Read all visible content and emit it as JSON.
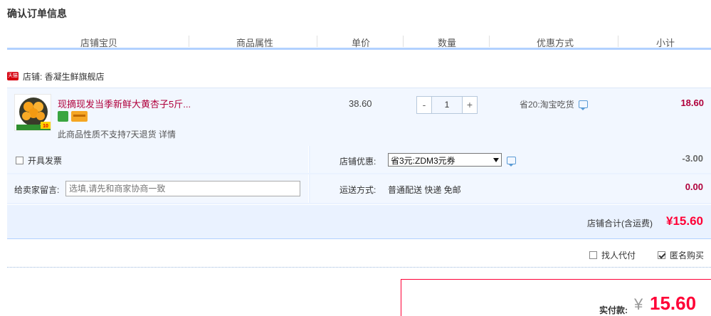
{
  "page": {
    "title": "确认订单信息"
  },
  "columns": [
    "店铺宝贝",
    "商品属性",
    "单价",
    "数量",
    "优惠方式",
    "小计"
  ],
  "shop": {
    "badge": "天猫",
    "label": "店铺: 香凝生鲜旗舰店"
  },
  "item": {
    "title": "现摘现发当季新鲜大黄杏子5斤...",
    "note": "此商品性质不支持7天退货 详情",
    "unit_price": "38.60",
    "quantity": "1",
    "minus": "-",
    "plus": "+",
    "promo": "省20:淘宝吃货",
    "subtotal": "18.60",
    "thumb_badge": "10"
  },
  "options": {
    "invoice_label": "开具发票",
    "message_label": "给卖家留言:",
    "message_placeholder": "选填,请先和商家协商一致",
    "coupon_label": "店铺优惠:",
    "coupon_selected": "省3元:ZDM3元券",
    "coupon_amount": "-3.00",
    "shipping_label": "运送方式:",
    "shipping_value": "普通配送 快递 免邮",
    "shipping_amount": "0.00"
  },
  "total": {
    "label": "店铺合计(含运费)",
    "value": "¥15.60"
  },
  "extras": {
    "proxy_pay": {
      "label": "找人代付",
      "checked": false
    },
    "anonymous": {
      "label": "匿名购买",
      "checked": true
    }
  },
  "payment": {
    "label": "实付款:",
    "symbol": "¥",
    "value": "15.60"
  },
  "colors": {
    "accent": "#ff0036",
    "title_red": "#b0003b",
    "header_border": "#b2d1ff",
    "row_bg": "#f2f7ff"
  }
}
